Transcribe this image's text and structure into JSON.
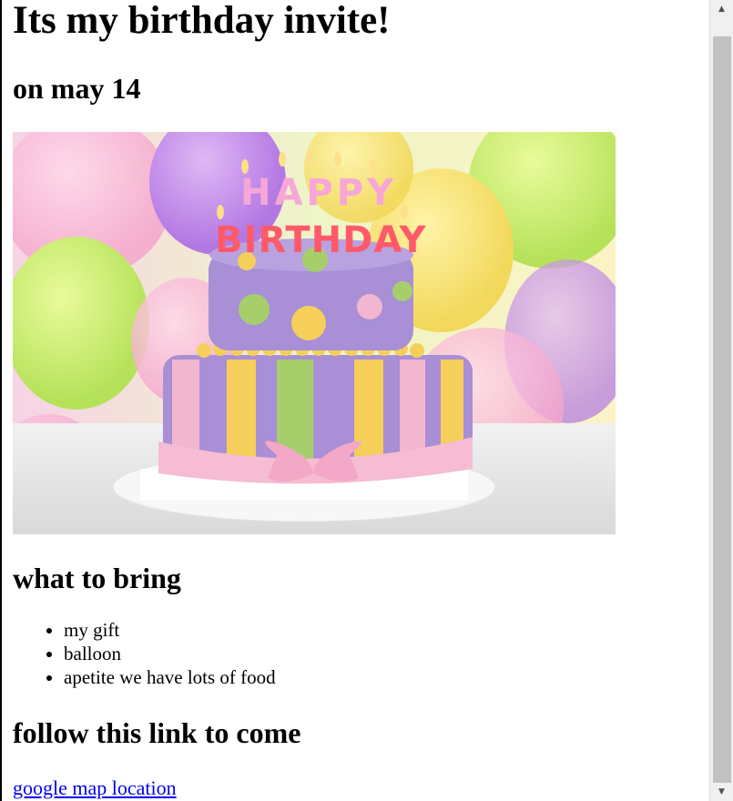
{
  "page": {
    "title": "Its my birthday invite!",
    "date": "on may 14",
    "bring_heading": "what to bring",
    "bring_items": [
      "my gift",
      "balloon",
      "apetite we have lots of food"
    ],
    "follow_heading": "follow this link to come",
    "map_link": "google map location"
  },
  "hero_image": {
    "banner_top": "HAPPY",
    "banner_bottom": "BIRTHDAY"
  },
  "colors": {
    "link": "#0000ee",
    "cake_purple": "#a88fd6",
    "cake_pink": "#f3b6cf",
    "cake_yellow": "#f5cf5a",
    "cake_green": "#a6cf6c"
  }
}
